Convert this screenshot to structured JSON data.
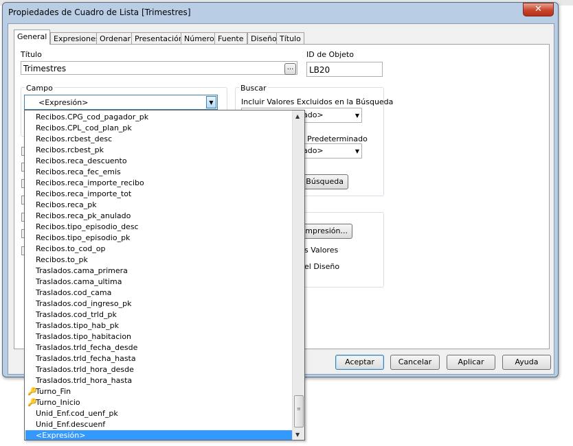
{
  "background": {
    "top_text": ""
  },
  "dialog": {
    "title": "Propiedades de Cuadro de Lista [Trimestres]",
    "close_label": "✕"
  },
  "tabs": [
    {
      "label": "General"
    },
    {
      "label": "Expresiones"
    },
    {
      "label": "Ordenar"
    },
    {
      "label": "Presentación"
    },
    {
      "label": "Número"
    },
    {
      "label": "Fuente"
    },
    {
      "label": "Diseño"
    },
    {
      "label": "Título"
    }
  ],
  "general": {
    "title_label": "Título",
    "title_value": "Trimestres",
    "ellipsis_label": "...",
    "object_id_label": "ID de Objeto",
    "object_id_value": "LB20",
    "campo_label": "Campo",
    "campo_value": "<Expresión>",
    "buscar_label": "Buscar",
    "buscar_excluded_label": "Incluir Valores Excluidos en la Búsqueda",
    "buscar_excluded_value": "nado>",
    "buscar_default_label": "Predeterminado",
    "buscar_default_value": "nado>",
    "buscar_button": "e Búsqueda",
    "print_button": "e Impresión...",
    "values_label": "s Valores",
    "design_label": "el Diseño"
  },
  "dropdown_items": [
    {
      "text": "Recibos.CPG_cod_pagador_pk",
      "key": false
    },
    {
      "text": "Recibos.CPL_cod_plan_pk",
      "key": false
    },
    {
      "text": "Recibos.rcbest_desc",
      "key": false
    },
    {
      "text": "Recibos.rcbest_pk",
      "key": false
    },
    {
      "text": "Recibos.reca_descuento",
      "key": false
    },
    {
      "text": "Recibos.reca_fec_emis",
      "key": false
    },
    {
      "text": "Recibos.reca_importe_recibo",
      "key": false
    },
    {
      "text": "Recibos.reca_importe_tot",
      "key": false
    },
    {
      "text": "Recibos.reca_pk",
      "key": false
    },
    {
      "text": "Recibos.reca_pk_anulado",
      "key": false
    },
    {
      "text": "Recibos.tipo_episodio_desc",
      "key": false
    },
    {
      "text": "Recibos.tipo_episodio_pk",
      "key": false
    },
    {
      "text": "Recibos.to_cod_op",
      "key": false
    },
    {
      "text": "Recibos.to_pk",
      "key": false
    },
    {
      "text": "Traslados.cama_primera",
      "key": false
    },
    {
      "text": "Traslados.cama_ultima",
      "key": false
    },
    {
      "text": "Traslados.cod_cama",
      "key": false
    },
    {
      "text": "Traslados.cod_ingreso_pk",
      "key": false
    },
    {
      "text": "Traslados.cod_trld_pk",
      "key": false
    },
    {
      "text": "Traslados.tipo_hab_pk",
      "key": false
    },
    {
      "text": "Traslados.tipo_habitacion",
      "key": false
    },
    {
      "text": "Traslados.trld_fecha_desde",
      "key": false
    },
    {
      "text": "Traslados.trld_fecha_hasta",
      "key": false
    },
    {
      "text": "Traslados.trld_hora_desde",
      "key": false
    },
    {
      "text": "Traslados.trld_hora_hasta",
      "key": false
    },
    {
      "text": "Turno_Fin",
      "key": true
    },
    {
      "text": "Turno_Inicio",
      "key": true
    },
    {
      "text": "Unid_Enf.cod_uenf_pk",
      "key": false
    },
    {
      "text": "Unid_Enf.descuenf",
      "key": false
    },
    {
      "text": "<Expresión>",
      "key": false,
      "selected": true
    }
  ],
  "footer": {
    "ok": "Aceptar",
    "cancel": "Cancelar",
    "apply": "Aplicar",
    "help": "Ayuda"
  }
}
